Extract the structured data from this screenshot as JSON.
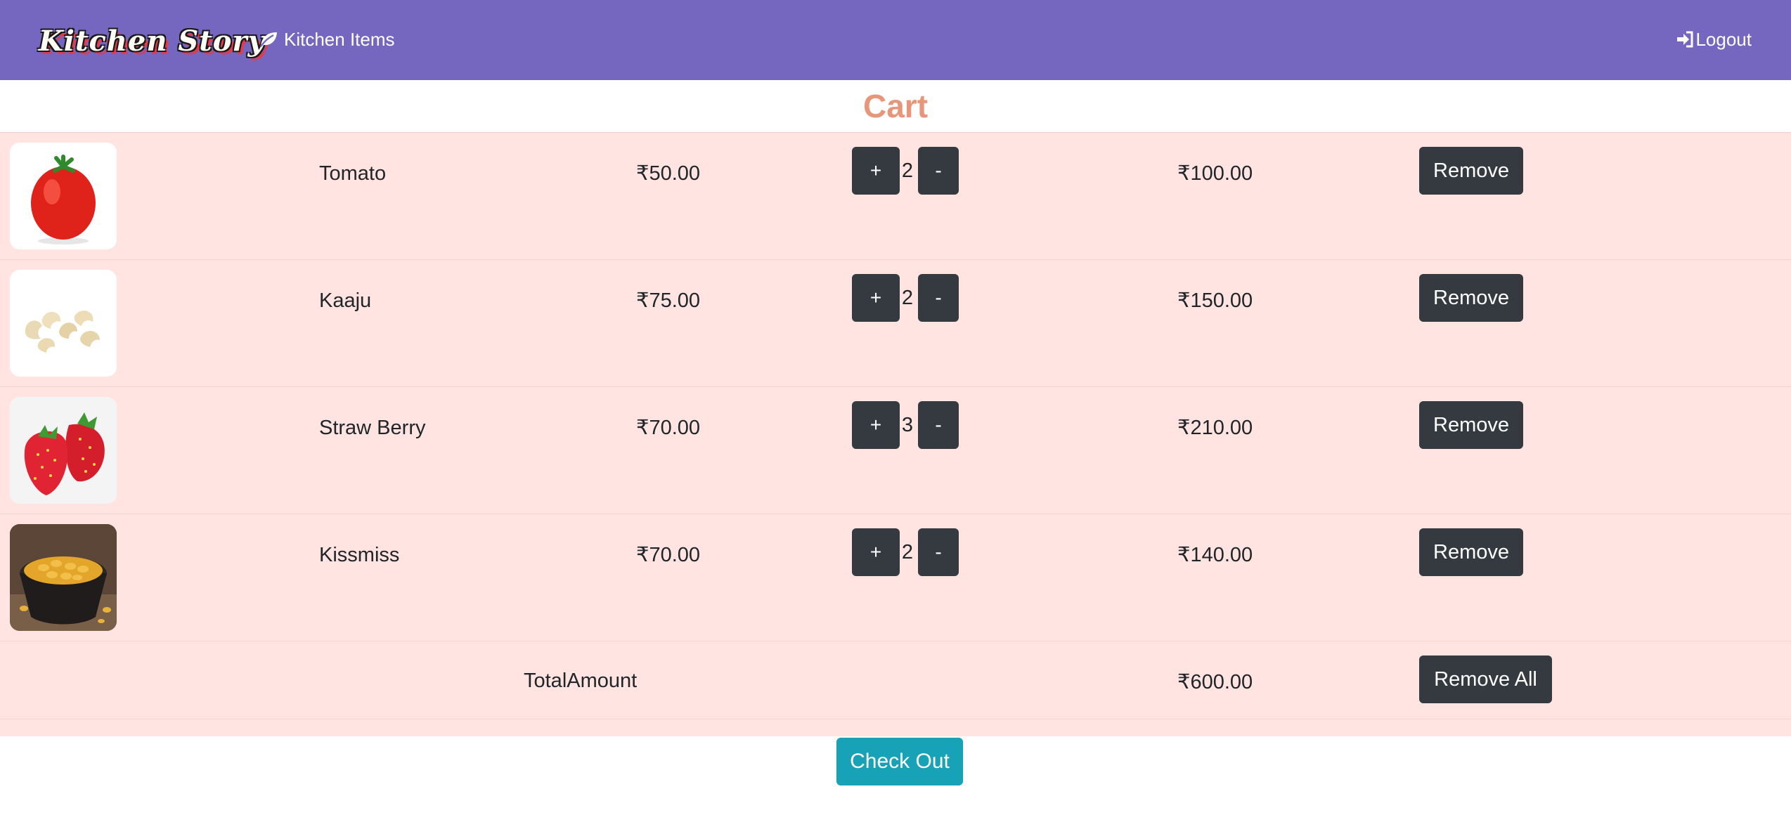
{
  "navbar": {
    "brand": "Kitchen Story",
    "kitchen_items_label": "Kitchen Items",
    "logout_label": "Logout",
    "color": "#7567c0"
  },
  "cart": {
    "title": "Cart",
    "items": [
      {
        "name": "Tomato",
        "price": "₹50.00",
        "qty": "2",
        "total": "₹100.00",
        "image": "tomato"
      },
      {
        "name": "Kaaju",
        "price": "₹75.00",
        "qty": "2",
        "total": "₹150.00",
        "image": "cashew"
      },
      {
        "name": "Straw Berry",
        "price": "₹70.00",
        "qty": "3",
        "total": "₹210.00",
        "image": "strawberry"
      },
      {
        "name": "Kissmiss",
        "price": "₹70.00",
        "qty": "2",
        "total": "₹140.00",
        "image": "raisins"
      }
    ],
    "plus_label": "+",
    "minus_label": "-",
    "remove_label": "Remove",
    "total_label": "TotalAmount",
    "total_amount": "₹600.00",
    "remove_all_label": "Remove All",
    "checkout_label": "Check Out"
  },
  "colors": {
    "title": "#e8967a",
    "table_bg": "#ffe4e1",
    "button_dark": "#343a40",
    "checkout": "#17a2b8"
  }
}
